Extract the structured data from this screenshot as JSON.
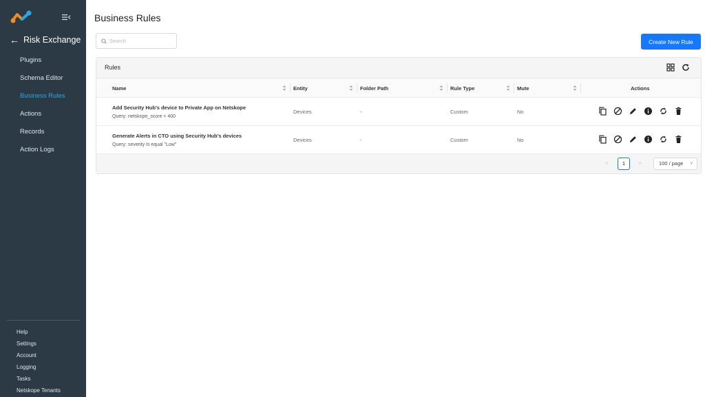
{
  "sidebar": {
    "title": "Risk Exchange",
    "items": [
      {
        "label": "Plugins"
      },
      {
        "label": "Schema Editor"
      },
      {
        "label": "Business Rules",
        "active": true
      },
      {
        "label": "Actions"
      },
      {
        "label": "Records"
      },
      {
        "label": "Action Logs"
      }
    ],
    "bottom_items": [
      {
        "label": "Help"
      },
      {
        "label": "Settings"
      },
      {
        "label": "Account"
      },
      {
        "label": "Logging"
      },
      {
        "label": "Tasks"
      },
      {
        "label": "Netskope Tenants"
      }
    ]
  },
  "header": {
    "title": "Business Rules",
    "search_placeholder": "Search",
    "create_label": "Create New Rule"
  },
  "card": {
    "title": "Rules"
  },
  "table": {
    "columns": [
      "Name",
      "Entity",
      "Folder Path",
      "Rule Type",
      "Mute",
      "Actions"
    ],
    "rows": [
      {
        "name": "Add Security Hub's device to Private App on Netskope",
        "query": "Query: netskope_score < 400",
        "entity": "Devices",
        "folder": "-",
        "type": "Custom",
        "mute": "No"
      },
      {
        "name": "Generate Alerts in CTO using Security Hub's devices",
        "query": "Query: severity Is equal \"Low\"",
        "entity": "Devices",
        "folder": "-",
        "type": "Custom",
        "mute": "No"
      }
    ]
  },
  "pagination": {
    "current": "1",
    "page_size": "100 / page",
    "prev": "<",
    "next": ">"
  },
  "colors": {
    "sidebar_bg": "#2b3a44",
    "accent": "#1677ff",
    "active_nav": "#2aa7e8"
  }
}
